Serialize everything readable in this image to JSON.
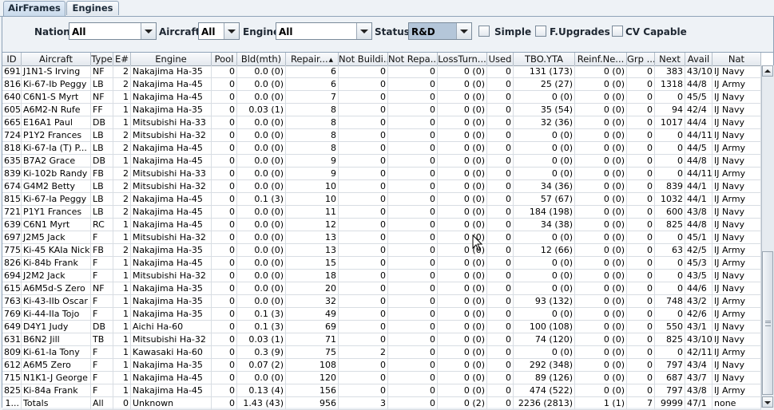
{
  "tabs": [
    "AirFrames",
    "Engines"
  ],
  "filters": {
    "nation_label": "Nation:",
    "nation_value": "All",
    "aircraft_label": "Aircraft:",
    "aircraft_value": "All",
    "engine_label": "Engine:",
    "engine_value": "All",
    "status_label": "Status:",
    "status_value": "R&D",
    "simple_label": "Simple",
    "fupgrades_label": "F.Upgrades",
    "cv_label": "CV Capable"
  },
  "table": {
    "sort_column": "Repair...",
    "columns": [
      "ID",
      "Aircraft",
      "Type",
      "E#",
      "Engine",
      "Pool",
      "Bld(mth)",
      "Repair...",
      "Not Buildi...",
      "Not Repa...",
      "LossTurn...",
      "Used",
      "TBO.YTA",
      "Reinf.Ne...",
      "Grp ...",
      "Next",
      "Avail",
      "Nat"
    ],
    "rows": [
      [
        "691",
        "J1N1-S Irving",
        "NF",
        "2",
        "Nakajima Ha-35",
        "0",
        "0.0 (0)",
        "6",
        "0",
        "0",
        "0 (0)",
        "0",
        "131 (173)",
        "0 (0)",
        "0",
        "383",
        "43/10",
        "IJ Navy"
      ],
      [
        "816",
        "Ki-67-Ib Peggy",
        "LB",
        "2",
        "Nakajima Ha-45",
        "0",
        "0.0 (0)",
        "6",
        "0",
        "0",
        "0 (0)",
        "0",
        "25 (27)",
        "0 (0)",
        "0",
        "1318",
        "44/8",
        "IJ Army"
      ],
      [
        "640",
        "C6N1-S Myrt",
        "NF",
        "1",
        "Nakajima Ha-45",
        "0",
        "0.0 (0)",
        "7",
        "0",
        "0",
        "0 (0)",
        "0",
        "0 (0)",
        "0 (0)",
        "0",
        "0",
        "45/5",
        "IJ Navy"
      ],
      [
        "605",
        "A6M2-N Rufe",
        "FF",
        "1",
        "Nakajima Ha-35",
        "0",
        "0.03 (1)",
        "8",
        "0",
        "0",
        "0 (0)",
        "0",
        "35 (54)",
        "0 (0)",
        "0",
        "94",
        "42/4",
        "IJ Navy"
      ],
      [
        "665",
        "E16A1 Paul",
        "DB",
        "1",
        "Mitsubishi Ha-33",
        "0",
        "0.0 (0)",
        "8",
        "0",
        "0",
        "0 (0)",
        "0",
        "32 (36)",
        "0 (0)",
        "0",
        "1017",
        "44/4",
        "IJ Navy"
      ],
      [
        "724",
        "P1Y2 Frances",
        "LB",
        "2",
        "Mitsubishi Ha-32",
        "0",
        "0.0 (0)",
        "8",
        "0",
        "0",
        "0 (0)",
        "0",
        "0 (0)",
        "0 (0)",
        "0",
        "0",
        "44/11",
        "IJ Navy"
      ],
      [
        "818",
        "Ki-67-Ia (T) P...",
        "LB",
        "2",
        "Nakajima Ha-45",
        "0",
        "0.0 (0)",
        "8",
        "0",
        "0",
        "0 (0)",
        "0",
        "0 (0)",
        "0 (0)",
        "0",
        "0",
        "44/5",
        "IJ Army"
      ],
      [
        "635",
        "B7A2 Grace",
        "DB",
        "1",
        "Nakajima Ha-45",
        "0",
        "0.0 (0)",
        "9",
        "0",
        "0",
        "0 (0)",
        "0",
        "0 (0)",
        "0 (0)",
        "0",
        "0",
        "44/8",
        "IJ Navy"
      ],
      [
        "839",
        "Ki-102b Randy",
        "FB",
        "2",
        "Mitsubishi Ha-33",
        "0",
        "0.0 (0)",
        "9",
        "0",
        "0",
        "0 (0)",
        "0",
        "0 (0)",
        "0 (0)",
        "0",
        "0",
        "44/11",
        "IJ Army"
      ],
      [
        "674",
        "G4M2 Betty",
        "LB",
        "2",
        "Mitsubishi Ha-32",
        "0",
        "0.0 (0)",
        "10",
        "0",
        "0",
        "0 (0)",
        "0",
        "34 (36)",
        "0 (0)",
        "0",
        "839",
        "44/1",
        "IJ Navy"
      ],
      [
        "815",
        "Ki-67-Ia Peggy",
        "LB",
        "2",
        "Nakajima Ha-45",
        "0",
        "0.1 (3)",
        "10",
        "0",
        "0",
        "0 (0)",
        "0",
        "57 (67)",
        "0 (0)",
        "0",
        "1032",
        "44/1",
        "IJ Army"
      ],
      [
        "721",
        "P1Y1 Frances",
        "LB",
        "2",
        "Nakajima Ha-45",
        "0",
        "0.0 (0)",
        "11",
        "0",
        "0",
        "0 (0)",
        "0",
        "184 (198)",
        "0 (0)",
        "0",
        "600",
        "43/8",
        "IJ Navy"
      ],
      [
        "639",
        "C6N1 Myrt",
        "RC",
        "1",
        "Nakajima Ha-45",
        "0",
        "0.0 (0)",
        "12",
        "0",
        "0",
        "0 (0)",
        "0",
        "34 (38)",
        "0 (0)",
        "0",
        "825",
        "44/8",
        "IJ Navy"
      ],
      [
        "697",
        "J2M5 Jack",
        "F",
        "1",
        "Mitsubishi Ha-32",
        "0",
        "0.0 (0)",
        "13",
        "0",
        "0",
        "0 (0)",
        "0",
        "0 (0)",
        "0 (0)",
        "0",
        "0",
        "45/1",
        "IJ Navy"
      ],
      [
        "775",
        "Ki-45 KAIa Nick",
        "FB",
        "2",
        "Nakajima Ha-35",
        "0",
        "0.0 (0)",
        "13",
        "0",
        "0",
        "0 (0)",
        "0",
        "12 (66)",
        "0 (0)",
        "0",
        "63",
        "42/5",
        "IJ Army"
      ],
      [
        "826",
        "Ki-84b Frank",
        "F",
        "1",
        "Nakajima Ha-45",
        "0",
        "0.0 (0)",
        "15",
        "0",
        "0",
        "0 (0)",
        "0",
        "0 (0)",
        "0 (0)",
        "0",
        "0",
        "45/3",
        "IJ Army"
      ],
      [
        "694",
        "J2M2 Jack",
        "F",
        "1",
        "Mitsubishi Ha-32",
        "0",
        "0.0 (0)",
        "18",
        "0",
        "0",
        "0 (0)",
        "0",
        "0 (0)",
        "0 (0)",
        "0",
        "0",
        "43/5",
        "IJ Navy"
      ],
      [
        "615",
        "A6M5d-S Zero",
        "NF",
        "1",
        "Nakajima Ha-35",
        "0",
        "0.0 (0)",
        "20",
        "0",
        "0",
        "0 (0)",
        "0",
        "0 (0)",
        "0 (0)",
        "0",
        "0",
        "44/6",
        "IJ Navy"
      ],
      [
        "763",
        "Ki-43-IIb Oscar",
        "F",
        "1",
        "Nakajima Ha-35",
        "0",
        "0.0 (0)",
        "32",
        "0",
        "0",
        "0 (0)",
        "0",
        "93 (132)",
        "0 (0)",
        "0",
        "748",
        "43/2",
        "IJ Army"
      ],
      [
        "769",
        "Ki-44-IIa Tojo",
        "F",
        "1",
        "Nakajima Ha-35",
        "0",
        "0.1 (3)",
        "49",
        "0",
        "0",
        "0 (0)",
        "0",
        "0 (0)",
        "0 (0)",
        "0",
        "0",
        "42/6",
        "IJ Army"
      ],
      [
        "649",
        "D4Y1 Judy",
        "DB",
        "1",
        "Aichi Ha-60",
        "0",
        "0.1 (3)",
        "69",
        "0",
        "0",
        "0 (0)",
        "0",
        "100 (108)",
        "0 (0)",
        "0",
        "550",
        "43/1",
        "IJ Navy"
      ],
      [
        "631",
        "B6N2 Jill",
        "TB",
        "1",
        "Mitsubishi Ha-32",
        "0",
        "0.03 (1)",
        "71",
        "0",
        "0",
        "0 (0)",
        "0",
        "74 (120)",
        "0 (0)",
        "0",
        "825",
        "43/10",
        "IJ Navy"
      ],
      [
        "809",
        "Ki-61-Ia Tony",
        "F",
        "1",
        "Kawasaki Ha-60",
        "0",
        "0.3 (9)",
        "75",
        "2",
        "0",
        "0 (0)",
        "0",
        "0 (0)",
        "0 (0)",
        "0",
        "0",
        "42/11",
        "IJ Army"
      ],
      [
        "612",
        "A6M5 Zero",
        "F",
        "1",
        "Nakajima Ha-35",
        "0",
        "0.07 (2)",
        "108",
        "0",
        "0",
        "0 (0)",
        "0",
        "292 (348)",
        "0 (0)",
        "0",
        "797",
        "43/4",
        "IJ Navy"
      ],
      [
        "715",
        "N1K1-J George",
        "F",
        "1",
        "Nakajima Ha-45",
        "0",
        "0.0 (0)",
        "120",
        "0",
        "0",
        "0 (0)",
        "0",
        "89 (126)",
        "0 (0)",
        "0",
        "687",
        "43/7",
        "IJ Navy"
      ],
      [
        "825",
        "Ki-84a Frank",
        "F",
        "1",
        "Nakajima Ha-45",
        "0",
        "0.13 (4)",
        "156",
        "0",
        "0",
        "0 (0)",
        "0",
        "474 (522)",
        "0 (0)",
        "0",
        "797",
        "43/8",
        "IJ Army"
      ],
      [
        "1...",
        "Totals",
        "All",
        "0",
        "Unknown",
        "0",
        "1.43 (43)",
        "956",
        "3",
        "0",
        "0 (2)",
        "0",
        "2236 (2813)",
        "1 (1)",
        "7",
        "9999",
        "47/1",
        "none"
      ]
    ]
  }
}
